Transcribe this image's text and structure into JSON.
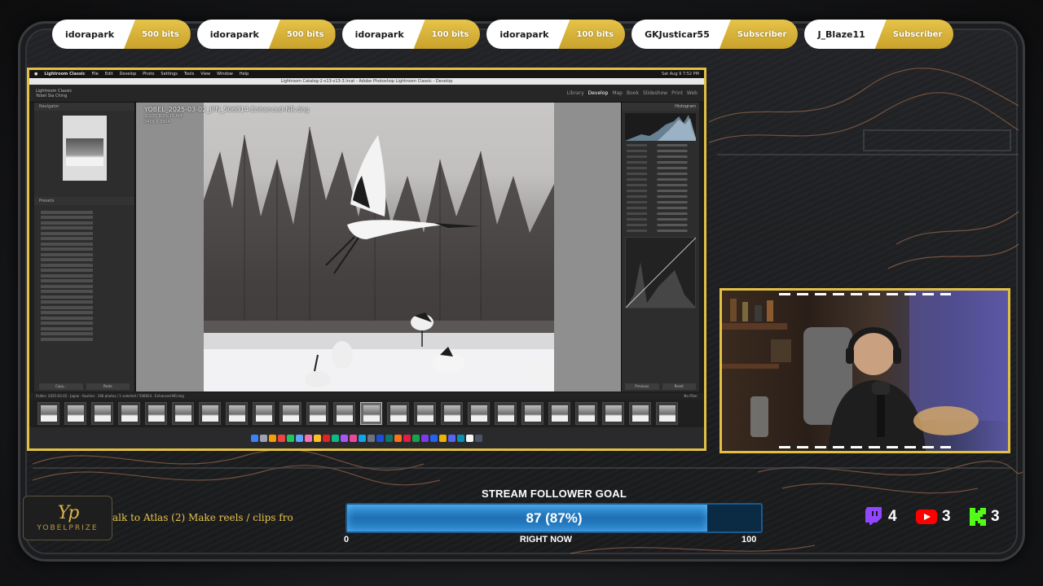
{
  "alerts": [
    {
      "name": "idorapark",
      "amount": "500 bits"
    },
    {
      "name": "idorapark",
      "amount": "500 bits"
    },
    {
      "name": "idorapark",
      "amount": "100 bits"
    },
    {
      "name": "idorapark",
      "amount": "100 bits"
    },
    {
      "name": "GKJusticar55",
      "amount": "Subscriber"
    },
    {
      "name": "J_Blaze11",
      "amount": "Subscriber"
    }
  ],
  "mac_menubar": {
    "app": "Lightroom Classic",
    "items": [
      "File",
      "Edit",
      "Develop",
      "Photo",
      "Settings",
      "Tools",
      "View",
      "Window",
      "Help"
    ],
    "clock": "Sat Aug 9 7:52 PM"
  },
  "window_title": "Lightroom Catalog-2-v13-v13-3.lrcat - Adobe Photoshop Lightroom Classic - Develop",
  "lightroom": {
    "brand_line1": "Lightroom Classic",
    "brand_line2": "Yobel Sia Ching",
    "modules": [
      "Library",
      "Develop",
      "Map",
      "Book",
      "Slideshow",
      "Print",
      "Web"
    ],
    "active_module": "Develop",
    "navigator_label": "Navigator",
    "presets_label": "Presets",
    "histogram_label": "Histogram",
    "filename": "YOBEL_2025-03-02_JPN_506814-Enhanced-NR.dng",
    "file_meta_1": "3/2/25 8:25:15 AM",
    "file_meta_2": "3456 x 3904",
    "left_footer": [
      "Copy...",
      "Paste"
    ],
    "right_footer": [
      "Previous",
      "Reset"
    ],
    "filmstrip_info": "Folder: 2025-03-02 - Japan - Kushiro · 166 photos / 1 selected / 506814 - Enhanced-NR.dng",
    "filter_label": "No Filter"
  },
  "ticker_text": "alk to Atlas (2) Make reels / clips fro",
  "branding": {
    "mark": "Yp",
    "name": "YOBELPRIZE"
  },
  "goal": {
    "title": "STREAM FOLLOWER GOAL",
    "value_text": "87 (87%)",
    "progress": 0.87,
    "min": "0",
    "max": "100",
    "subtitle": "RIGHT NOW"
  },
  "social": {
    "twitch": "4",
    "youtube": "3",
    "kick": "3",
    "colors": {
      "twitch": "#9146ff",
      "youtube": "#ff0000",
      "kick": "#53fc18"
    }
  },
  "accent_color": "#e2c044"
}
